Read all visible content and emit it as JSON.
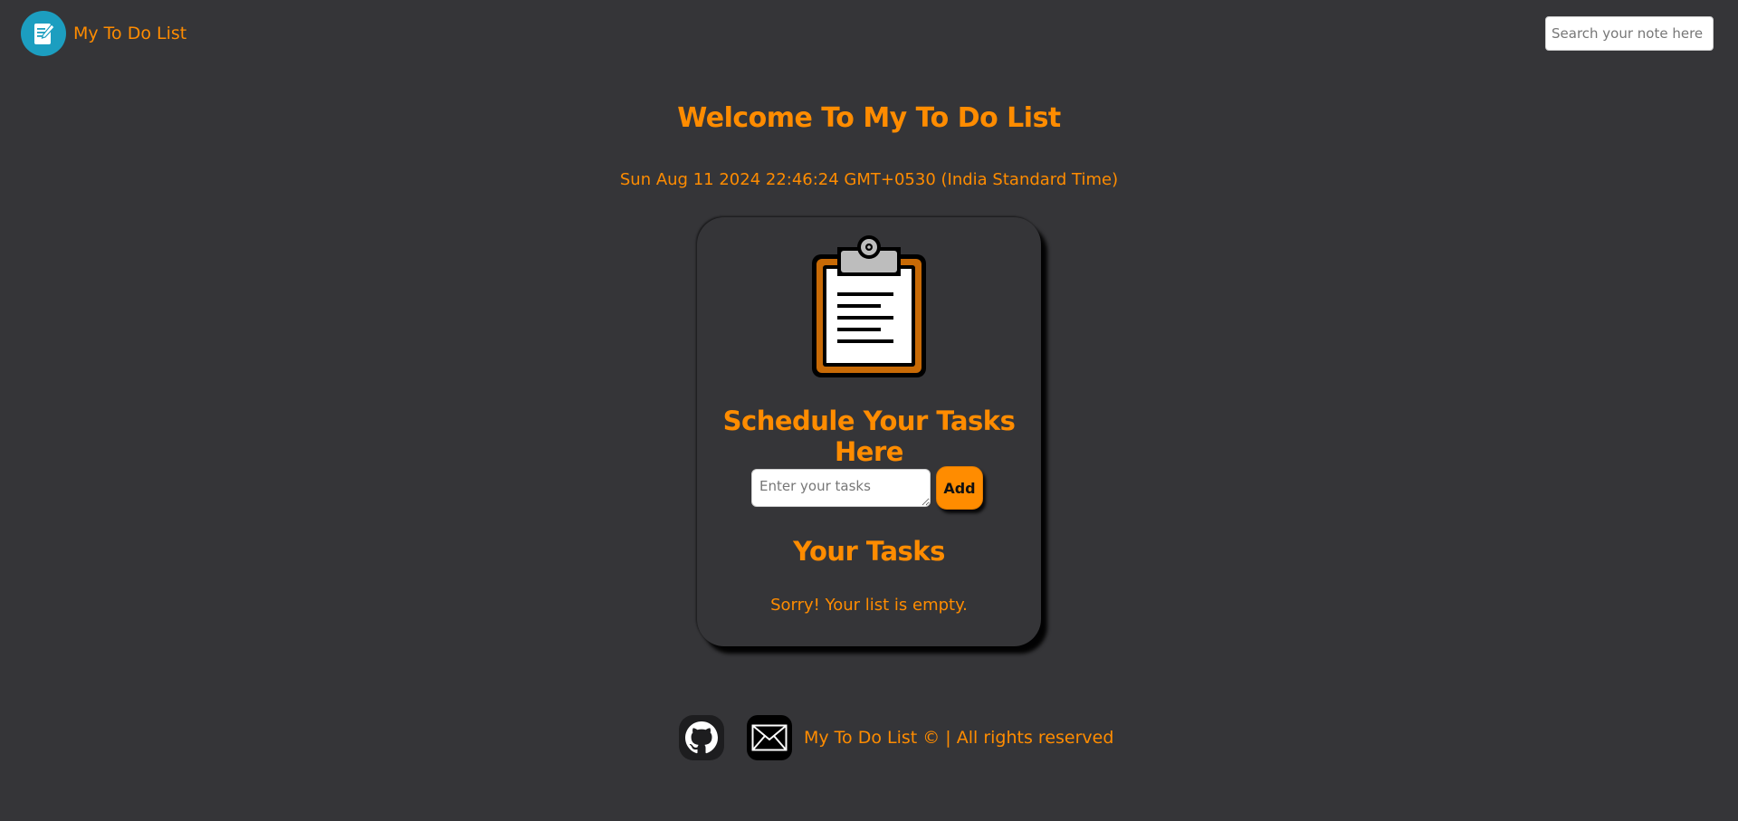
{
  "navbar": {
    "brand_name": "My To Do List",
    "logo_icon": "note-edit-icon",
    "search_placeholder": "Search your note here"
  },
  "main": {
    "welcome_title": "Welcome To My To Do List",
    "date_text": "Sun Aug 11 2024 22:46:24 GMT+0530 (India Standard Time)"
  },
  "card": {
    "illustration_icon": "clipboard-icon",
    "title": "Schedule Your Tasks Here",
    "task_placeholder": "Enter your tasks",
    "add_label": "Add",
    "tasks_title": "Your Tasks",
    "empty_message": "Sorry! Your list is empty."
  },
  "footer": {
    "github_icon": "github-icon",
    "mail_icon": "mail-icon",
    "copyright_text": "My To Do List © | All rights reserved"
  },
  "colors": {
    "background": "#353538",
    "accent": "#ff8c00",
    "logo_bg": "#1c9ec0"
  }
}
